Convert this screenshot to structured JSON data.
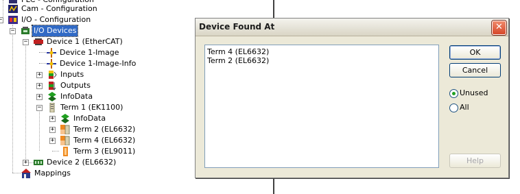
{
  "tree": {
    "items": [
      {
        "label": "PLC - Configuration"
      },
      {
        "label": "Cam - Configuration"
      },
      {
        "label": "I/O - Configuration"
      },
      {
        "label": "I/O Devices"
      },
      {
        "label": "Device 1 (EtherCAT)"
      },
      {
        "label": "Device 1-Image"
      },
      {
        "label": "Device 1-Image-Info"
      },
      {
        "label": "Inputs"
      },
      {
        "label": "Outputs"
      },
      {
        "label": "InfoData"
      },
      {
        "label": "Term 1 (EK1100)"
      },
      {
        "label": "InfoData"
      },
      {
        "label": "Term 2 (EL6632)"
      },
      {
        "label": "Term 4 (EL6632)"
      },
      {
        "label": "Term 3 (EL9011)"
      },
      {
        "label": "Device 2 (EL6632)"
      },
      {
        "label": "Mappings"
      }
    ],
    "expand_plus": "+",
    "expand_minus": "−"
  },
  "dialog": {
    "title": "Device Found At",
    "close_glyph": "✕",
    "list_items": [
      "Term 4 (EL6632)",
      "Term 2 (EL6632)"
    ],
    "ok_label": "OK",
    "cancel_label": "Cancel",
    "radio_unused": "Unused",
    "radio_all": "All",
    "help_label": "Help",
    "selected_radio": "Unused"
  },
  "colors": {
    "selection": "#316ac5",
    "dialog_bg": "#ece9d8",
    "close_button": "#d6482a",
    "radio_dot": "#21a121"
  }
}
